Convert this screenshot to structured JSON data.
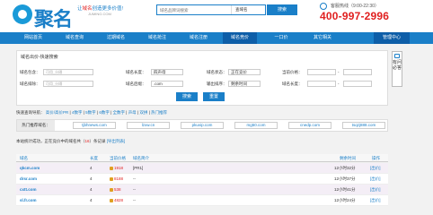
{
  "header": {
    "logo_text": "聚名",
    "slogan_pre": "让",
    "slogan_red": "域名",
    "slogan_post": "创造更多价值!",
    "site_url": "JUMING.COM",
    "search_placeholder": "域名品牌词搜索",
    "search_select": "查域名",
    "search_button": "搜索",
    "hotline_label": "客服热线（9:00-22:30）",
    "hotline_number": "400-997-2996"
  },
  "nav": {
    "items": [
      "网站首页",
      "域名查询",
      "过期域名",
      "域名抢注",
      "域名注册",
      "域名竞价",
      "一口价",
      "其它相关"
    ],
    "active_index": 5,
    "admin": "管理中心"
  },
  "filter": {
    "title": "域名出价-快速搜索",
    "row1": {
      "kw_include_label": "域名包含：",
      "kw_include_placeholder": "可用_分隔",
      "length_label": "域名长度：",
      "length_value": "四声母",
      "status_label": "域名状态：",
      "status_value": "正在竞价",
      "price_label": "当前价格："
    },
    "row2": {
      "kw_exclude_label": "域名排除：",
      "kw_exclude_placeholder": "可用_分隔",
      "suffix_label": "域名后缀：",
      "suffix_value": ".com",
      "sort_label": "输出排序：",
      "sort_value": "剩余时间",
      "len_label": "域名长度："
    },
    "dash": "-",
    "search_button": "搜索",
    "reset_button": "重置"
  },
  "quicklinks": {
    "label": "快速查询导航：",
    "items": [
      "高价/高价PR",
      "4数字",
      "5数字",
      "6数字",
      "全数字",
      "声母",
      "双拼",
      "热门推荐"
    ]
  },
  "hot_domains": {
    "label": "热门推荐域名：",
    "items": [
      "tjbhnews.com",
      "lzxw.cn",
      "pkuvip.com",
      "mg50.com",
      "cnedp.com",
      "tsqzj888.com"
    ]
  },
  "notice": {
    "pre": "本站统计成功，正在竞价中的域名共（",
    "count": "16",
    "post": "）条记录",
    "link": "[导出列表]"
  },
  "table": {
    "headers": [
      "域名",
      "长度",
      "当前价格",
      "域名简介",
      "剩余时间",
      "操作"
    ],
    "rows": [
      {
        "domain": "qkcm.com",
        "length": "4",
        "price": "1918",
        "intro": "[PR1]",
        "remain": "12小时32分",
        "action": "[出价]"
      },
      {
        "domain": "drsr.com",
        "length": "4",
        "price": "8188",
        "intro": "--",
        "remain": "12小时37分",
        "action": "[出价]"
      },
      {
        "domain": "cxtt.com",
        "length": "4",
        "price": "538",
        "intro": "--",
        "remain": "12小时41分",
        "action": "[出价]"
      },
      {
        "domain": "sl.fr.com",
        "length": "4",
        "price": "4828",
        "intro": "--",
        "remain": "12小时24分",
        "action": "[出价]"
      }
    ]
  },
  "side_tab": {
    "label": "有问必答"
  },
  "colors": {
    "brand_blue": "#1a7fc8",
    "nav_active": "#0e5ea8",
    "price_red": "#e02020",
    "row_alt": "#f4eef6"
  }
}
